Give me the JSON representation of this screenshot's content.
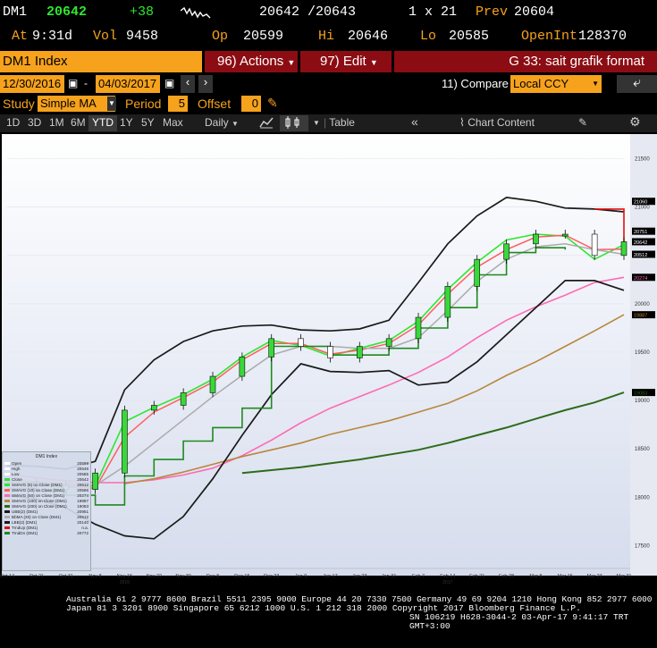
{
  "quote": {
    "ticker": "DM1",
    "last": "20642",
    "change": "+38",
    "bid_ask": "20642 /20643",
    "size": "1 x 21",
    "prev_label": "Prev",
    "prev": "20604",
    "at_label": "At",
    "time": "9:31d",
    "vol_label": "Vol",
    "vol": "9458",
    "op_label": "Op",
    "op": "20599",
    "hi_label": "Hi",
    "hi": "20646",
    "lo_label": "Lo",
    "lo": "20585",
    "oi_label": "OpenInt",
    "oi": "128370"
  },
  "toolbar": {
    "index_name": "DM1 Index",
    "actions": "96) Actions",
    "edit": "97) Edit",
    "function": "G 33: sait grafik format",
    "date_from": "12/30/2016",
    "date_to": "04/03/2017",
    "compare_label": "11) Compare",
    "compare_value": "Local CCY",
    "study_label": "Study",
    "study_value": "Simple MA",
    "period_label": "Period",
    "period_value": "5",
    "offset_label": "Offset",
    "offset_value": "0",
    "ranges": [
      "1D",
      "3D",
      "1M",
      "6M",
      "YTD",
      "1Y",
      "5Y",
      "Max"
    ],
    "selected_range": "YTD",
    "frequency": "Daily",
    "table_label": "Table",
    "chart_content": "Chart Content"
  },
  "colors": {
    "price_up": "#39d839",
    "price_down": "#ffffff",
    "sma5": "#2ee62e",
    "sma10": "#ff5d5d",
    "sma50": "#ff69b4",
    "sma100": "#b8863b",
    "sma200": "#2e6b1a",
    "bollinger": "#1a1a1a",
    "bbma": "#aaaaaa",
    "step": "#1e8a1e"
  },
  "chart_data": {
    "type": "line",
    "title": "DM1 Index",
    "ylim": [
      17300,
      21700
    ],
    "yticks": [
      17500,
      18000,
      18500,
      19000,
      19500,
      20000,
      20500,
      21000,
      21500
    ],
    "x": [
      "Oct 14",
      "Oct 21",
      "Oct 31",
      "Nov 8",
      "Nov 15",
      "Nov 22",
      "Nov 30",
      "Dec 8",
      "Dec 15",
      "Dec 23",
      "Jan 9",
      "Jan 17",
      "Jan 23",
      "Jan 31",
      "Feb 7",
      "Feb 14",
      "Feb 21",
      "Feb 28",
      "Mar 8",
      "Mar 15",
      "Mar 23",
      "Mar 31"
    ],
    "year_labels": [
      {
        "at": "Nov 15",
        "text": "2016"
      },
      {
        "at": "Feb 14",
        "text": "2017"
      }
    ],
    "series": [
      {
        "name": "Close",
        "values": [
          18150,
          18120,
          18080,
          18250,
          18900,
          18950,
          19080,
          19250,
          19450,
          19640,
          19560,
          19440,
          19560,
          19640,
          19860,
          20180,
          20460,
          20620,
          20720,
          20720,
          20500,
          20642
        ]
      },
      {
        "name": "SMAVG (5) on Close (DM1)",
        "values": [
          18160,
          18130,
          18100,
          18120,
          18780,
          18930,
          19060,
          19220,
          19450,
          19620,
          19570,
          19460,
          19540,
          19620,
          19820,
          20150,
          20430,
          20660,
          20720,
          20700,
          20460,
          20612
        ]
      },
      {
        "name": "SMAVG (10) on Close (DM1)",
        "values": [
          18170,
          18150,
          18120,
          18090,
          18620,
          18880,
          19030,
          19190,
          19420,
          19590,
          19590,
          19480,
          19520,
          19590,
          19780,
          20100,
          20380,
          20560,
          20690,
          20710,
          20560,
          20566
        ]
      },
      {
        "name": "SMAVG (50) on Close (DM1)",
        "values": [
          18240,
          18200,
          18170,
          18150,
          18150,
          18180,
          18230,
          18300,
          18430,
          18590,
          18770,
          18920,
          19040,
          19160,
          19290,
          19450,
          19650,
          19830,
          19970,
          20090,
          20220,
          20274
        ]
      },
      {
        "name": "SMAVG (100) on Close (DM1)",
        "values": [
          null,
          null,
          null,
          null,
          18140,
          18190,
          18260,
          18340,
          18420,
          18490,
          18560,
          18650,
          18720,
          18790,
          18880,
          18970,
          19100,
          19260,
          19400,
          19560,
          19720,
          19887
        ]
      },
      {
        "name": "SMAVG (200) on Close (DM1)",
        "values": [
          null,
          null,
          null,
          null,
          null,
          null,
          null,
          null,
          18250,
          18280,
          18310,
          18350,
          18390,
          18440,
          18490,
          18560,
          18640,
          18720,
          18810,
          18900,
          18980,
          19083
        ]
      },
      {
        "name": "BbMA (20) on Close (DM1)",
        "values": [
          18170,
          18160,
          18140,
          18120,
          18320,
          18560,
          18800,
          19040,
          19260,
          19470,
          19560,
          19560,
          19540,
          19540,
          19650,
          19930,
          20230,
          20460,
          20590,
          20620,
          20560,
          20512
        ]
      },
      {
        "name": "UBB(2) (DM1)",
        "values": [
          18330,
          18320,
          18290,
          18370,
          19110,
          19420,
          19610,
          19720,
          19770,
          19780,
          19730,
          19720,
          19740,
          19830,
          20220,
          20620,
          20910,
          21100,
          21060,
          20990,
          20980,
          20951
        ]
      },
      {
        "name": "LBB(2) (DM1)",
        "values": [
          18020,
          17980,
          17890,
          17720,
          17600,
          17570,
          17800,
          18190,
          18640,
          19060,
          19380,
          19300,
          19290,
          19310,
          19160,
          19190,
          19400,
          19680,
          19960,
          20240,
          20240,
          20140
        ]
      },
      {
        "name": "TrndUp (DM1)",
        "values": [
          null,
          null,
          null,
          null,
          null,
          null,
          null,
          null,
          null,
          null,
          null,
          null,
          null,
          null,
          null,
          null,
          null,
          null,
          null,
          null,
          20980,
          20600
        ]
      },
      {
        "name": "TrndDn (DM1)",
        "values": [
          18090,
          18060,
          18020,
          17920,
          18220,
          18390,
          18580,
          18720,
          18920,
          19560,
          19560,
          19470,
          19470,
          19540,
          19750,
          19960,
          20300,
          20530,
          20580,
          20560,
          null,
          null
        ]
      }
    ],
    "axis_price_labels": [
      {
        "value": "21060",
        "color": "#ffffff"
      },
      {
        "value": "20751",
        "color": "#ffffff"
      },
      {
        "value": "20642",
        "color": "#ffffff"
      },
      {
        "value": "20512",
        "color": "#ffffff"
      },
      {
        "value": "20274",
        "color": "#ff69b4"
      },
      {
        "value": "19887",
        "color": "#b8863b"
      },
      {
        "value": "19083",
        "color": "#2e6b1a"
      }
    ],
    "legend": {
      "title": "DM1 Index",
      "placement": "bottom-left",
      "rows": [
        {
          "label": "Open",
          "value": "20599"
        },
        {
          "label": "High",
          "value": "20646"
        },
        {
          "label": "Low",
          "value": "20585"
        },
        {
          "label": "Close",
          "value": "20642"
        },
        {
          "label": "SMAVG (5) on Close (DM1)",
          "value": "20612"
        },
        {
          "label": "SMAVG (10) on Close (DM1)",
          "value": "20566"
        },
        {
          "label": "SMAVG (50) on Close (DM1)",
          "value": "20274"
        },
        {
          "label": "SMAVG (100) on Close (DM1)",
          "value": "19887"
        },
        {
          "label": "SMAVG (200) on Close (DM1)",
          "value": "19083"
        },
        {
          "label": "UBB(2) (DM1)",
          "value": "20951"
        },
        {
          "label": "BbMA (20) on Close (DM1)",
          "value": "20512"
        },
        {
          "label": "LBB(2) (DM1)",
          "value": "20140"
        },
        {
          "label": "TrndUp (DM1)",
          "value": "n.a."
        },
        {
          "label": "TrndDn (DM1)",
          "value": "20772"
        }
      ]
    }
  },
  "footer": {
    "line1": "Australia 61 2 9777 8600 Brazil 5511 2395 9000 Europe 44 20 7330 7500 Germany 49 69 9204 1210 Hong Kong 852 2977 6000",
    "line2": "Japan 81 3 3201 8900      Singapore 65 6212 1000      U.S. 1 212 318 2000      Copyright 2017 Bloomberg Finance L.P.",
    "line3": "SN 106219 H628-3044-2 03-Apr-17  9:41:17 TRT  GMT+3:00"
  }
}
